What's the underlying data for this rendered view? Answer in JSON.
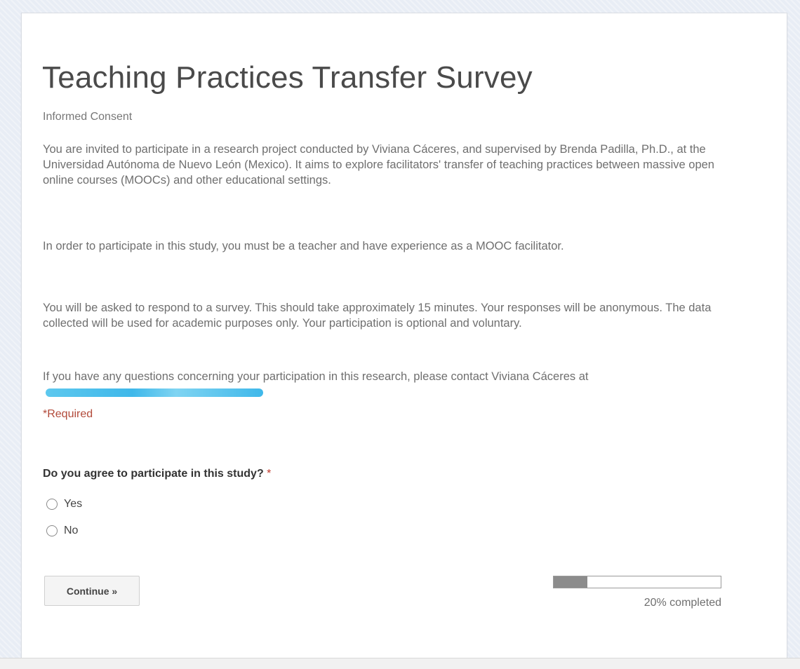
{
  "form": {
    "title": "Teaching Practices Transfer Survey",
    "subtitle": "Informed Consent",
    "paragraphs": [
      "You are invited to participate in a research project conducted by Viviana Cáceres, and supervised by Brenda Padilla, Ph.D., at the Universidad Autónoma de Nuevo León (Mexico). It aims to explore facilitators' transfer of teaching practices between massive open online courses (MOOCs) and other educational settings.",
      "In order to participate in this study, you must be a teacher and have experience as a MOOC facilitator.",
      "You will be asked to respond to a survey. This should take approximately 15 minutes. Your responses will be anonymous. The data collected will be used for academic purposes only. Your participation is optional and voluntary.",
      "If you have any questions concerning your participation in this research, please contact Viviana Cáceres at"
    ],
    "required_note": "*Required",
    "question": {
      "text": "Do you agree to participate in this study?",
      "required_marker": "*",
      "options": [
        "Yes",
        "No"
      ]
    },
    "continue_label": "Continue »",
    "progress": {
      "percent": 20,
      "label": "20% completed"
    }
  },
  "colors": {
    "background": "#e8edf5",
    "required_red": "#b24a3a",
    "progress_fill": "#8c8c8c",
    "redaction": "#3fb8ea"
  }
}
